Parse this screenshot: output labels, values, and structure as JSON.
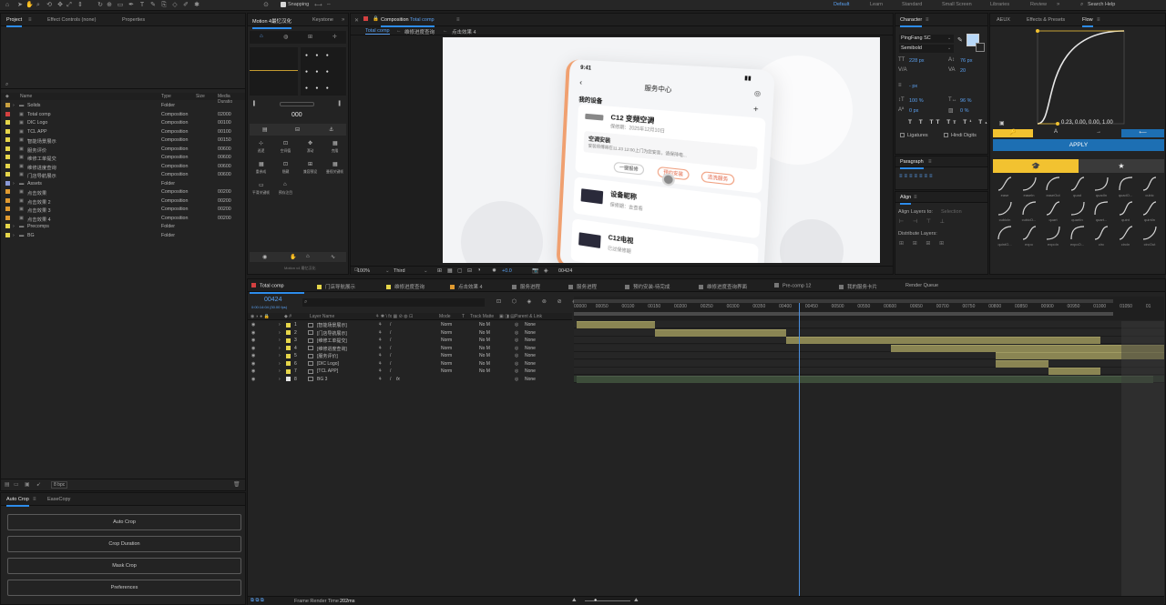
{
  "toolbar": {
    "snapping": "Snapping",
    "search_placeholder": "Search Help"
  },
  "workspaces": [
    "Default",
    "Learn",
    "Standard",
    "Small Screen",
    "Libraries",
    "Review"
  ],
  "project_panel": {
    "tabs": [
      "Project",
      "Effect Controls (none)",
      "Properties"
    ],
    "search_placeholder": "",
    "columns": [
      "Name",
      "Type",
      "Size",
      "Media Duratio"
    ],
    "items": [
      {
        "name": "Solids",
        "type": "Folder",
        "dur": "",
        "color": "#c8a040",
        "folder": true
      },
      {
        "name": "Total comp",
        "type": "Composition",
        "dur": "02000",
        "color": "#d44040",
        "folder": false
      },
      {
        "name": "DIC Logo",
        "type": "Composition",
        "dur": "00100",
        "color": "#e6d64a",
        "folder": false
      },
      {
        "name": "TCL APP",
        "type": "Composition",
        "dur": "00100",
        "color": "#e6d64a",
        "folder": false
      },
      {
        "name": "智能场景展示",
        "type": "Composition",
        "dur": "00150",
        "color": "#e6d64a",
        "folder": false
      },
      {
        "name": "服务评价",
        "type": "Composition",
        "dur": "00600",
        "color": "#e6d64a",
        "folder": false
      },
      {
        "name": "维修工单提交",
        "type": "Composition",
        "dur": "00600",
        "color": "#e6d64a",
        "folder": false
      },
      {
        "name": "维修进度查询",
        "type": "Composition",
        "dur": "00600",
        "color": "#e6d64a",
        "folder": false
      },
      {
        "name": "门店导航展示",
        "type": "Composition",
        "dur": "00600",
        "color": "#e6d64a",
        "folder": false
      },
      {
        "name": "Assets",
        "type": "Folder",
        "dur": "",
        "color": "#8a9ad8",
        "folder": true
      },
      {
        "name": "点击效果",
        "type": "Composition",
        "dur": "00200",
        "color": "#e09a30",
        "folder": false
      },
      {
        "name": "点击效果 2",
        "type": "Composition",
        "dur": "00200",
        "color": "#e09a30",
        "folder": false
      },
      {
        "name": "点击效果 3",
        "type": "Composition",
        "dur": "00200",
        "color": "#e09a30",
        "folder": false
      },
      {
        "name": "点击效果 4",
        "type": "Composition",
        "dur": "00200",
        "color": "#e09a30",
        "folder": false
      },
      {
        "name": "Precomps",
        "type": "Folder",
        "dur": "",
        "color": "#e6d64a",
        "folder": true
      },
      {
        "name": "BG",
        "type": "Folder",
        "dur": "",
        "color": "#e6d64a",
        "folder": true
      }
    ],
    "bpc": "8 bpc"
  },
  "autocrop": {
    "tabs": [
      "Auto Crop",
      "EaseCopy"
    ],
    "buttons": [
      "Auto Crop",
      "Crop Duration",
      "Mask Crop",
      "Preferences"
    ]
  },
  "motion_panel": {
    "tabs": [
      "Motion 4最忆汉化",
      "Keystone"
    ],
    "readout": "000",
    "labels_row1": [
      "巡逻",
      "空间值",
      "漂动",
      "克隆"
    ],
    "labels_row2": [
      "重参成",
      "隐藏",
      "兼容预设",
      "曼视关键帧"
    ],
    "labels_row3": [
      "平滑关键帧",
      "预存注目"
    ],
    "footer": "Motion v4 最忆汉化"
  },
  "composition": {
    "header": "Composition",
    "name": "Total comp",
    "breadcrumbs": [
      "Total comp",
      "维修进度查询",
      "点击效果 4"
    ],
    "zoom": "100%",
    "resolution": "Third",
    "exposure": "+0.0",
    "timecode": "00424"
  },
  "phone": {
    "time": "9:41",
    "title": "服务中心",
    "my_devices": "我的设备",
    "card1_title": "C12 变频空调",
    "card1_sub": "保修期：2025年12月10日",
    "install_title": "空调安装",
    "install_desc": "安装师傅将在11.23 12:00上门为您安装，请保持电...",
    "btn1": "一键报修",
    "btn2": "预约安装",
    "btn3": "清洗服务",
    "card2_title": "设备昵称",
    "card2_sub": "保修期：去查看",
    "card3_title": "C12电视",
    "card3_sub": "已过保修期"
  },
  "character": {
    "tab": "Character",
    "font": "PingFang SC",
    "style": "Semibold",
    "size": "228 px",
    "leading": "76 px",
    "tracking": "20",
    "stroke": "- px",
    "vscale": "100 %",
    "hscale": "96 %",
    "baseline": "0 px",
    "tsume": "0 %",
    "ligatures": "Ligatures",
    "hindi": "Hindi Digits",
    "fill_color": "#b8d8f8"
  },
  "paragraph": {
    "tab": "Paragraph"
  },
  "align": {
    "tab": "Align",
    "align_to_label": "Align Layers to:",
    "align_to_value": "Selection",
    "distribute": "Distribute Layers:"
  },
  "flow": {
    "tabs": [
      "AEUX",
      "Effects & Presets",
      "Flow"
    ],
    "values": "0.23, 0.00, 0.00, 1.00",
    "apply": "APPLY",
    "easings_row1": [
      "ease",
      "easeIn",
      "easeOut",
      "quad",
      "quadIn",
      "quadO...",
      "cubic"
    ],
    "easings_row2": [
      "cubicIn",
      "cubicO...",
      "quart",
      "quartIn",
      "quart...",
      "quint",
      "quintIn"
    ],
    "easings_row3": [
      "quintO...",
      "expo",
      "expoIn",
      "expoO...",
      "circ",
      "circIn",
      "circOut"
    ]
  },
  "timeline": {
    "tabs": [
      {
        "label": "Total comp",
        "color": "#d44040"
      },
      {
        "label": "门店导航展示",
        "color": "#e6d64a"
      },
      {
        "label": "维修进度查询",
        "color": "#e6d64a"
      },
      {
        "label": "点击效果 4",
        "color": "#e09a30"
      },
      {
        "label": "服务进程",
        "color": "#777777"
      },
      {
        "label": "服务进程",
        "color": "#777777"
      },
      {
        "label": "预约安装-待完成",
        "color": "#777777"
      },
      {
        "label": "维修进度查询界面",
        "color": "#777777"
      },
      {
        "label": "Pre-comp 12",
        "color": "#777777"
      },
      {
        "label": "我的服务卡片",
        "color": "#777777"
      },
      {
        "label": "Render Queue",
        "color": ""
      }
    ],
    "timecode": "00424",
    "subtime": "0:00:14:04 (30.00 fps)",
    "col_layer": "Layer Name",
    "col_mode": "Mode",
    "col_t": "T",
    "col_matte": "Track Matte",
    "col_parent": "Parent & Link",
    "ruler": [
      "00000",
      "00050",
      "00100",
      "00150",
      "00200",
      "00250",
      "00300",
      "00350",
      "00400",
      "00450",
      "00500",
      "00550",
      "00600",
      "00650",
      "00700",
      "00750",
      "00800",
      "00850",
      "00900",
      "00950",
      "01000",
      "01050",
      "01"
    ],
    "layers": [
      {
        "num": "1",
        "name": "[智能场景展示]",
        "mode": "Norm",
        "matte": "No M",
        "parent": "None",
        "start": 0,
        "end": 150
      },
      {
        "num": "2",
        "name": "[门店导航展示]",
        "mode": "Norm",
        "matte": "No M",
        "parent": "None",
        "start": 150,
        "end": 400
      },
      {
        "num": "3",
        "name": "[维修工单提交]",
        "mode": "Norm",
        "matte": "No M",
        "parent": "None",
        "start": 400,
        "end": 1000
      },
      {
        "num": "4",
        "name": "[维修进度查询]",
        "mode": "Norm",
        "matte": "No M",
        "parent": "None",
        "start": 600,
        "end": 1200
      },
      {
        "num": "5",
        "name": "[服务评价]",
        "mode": "Norm",
        "matte": "No M",
        "parent": "None",
        "start": 800,
        "end": 1400
      },
      {
        "num": "6",
        "name": "[DIC Logo]",
        "mode": "Norm",
        "matte": "No M",
        "parent": "None",
        "start": 800,
        "end": 900
      },
      {
        "num": "7",
        "name": "[TCL APP]",
        "mode": "Norm",
        "matte": "No M",
        "parent": "None",
        "start": 900,
        "end": 1000
      },
      {
        "num": "8",
        "name": "BG 3",
        "mode": "",
        "matte": "",
        "parent": "None",
        "start": 0,
        "end": 1100
      }
    ],
    "playhead": 424,
    "work_end": 1040,
    "footer_label": "Frame Render Time",
    "footer_value": "202ms"
  }
}
